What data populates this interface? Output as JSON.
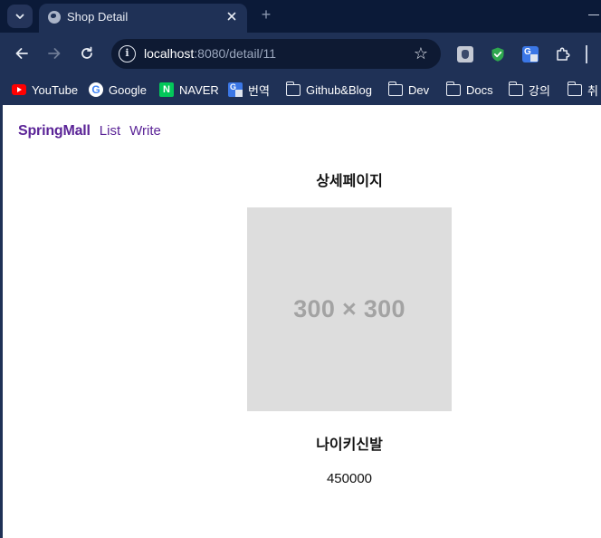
{
  "browser": {
    "tab_title": "Shop Detail",
    "new_tab_symbol": "+",
    "url_host": "localhost",
    "url_rest": ":8080/detail/11",
    "bookmarks": [
      {
        "label": "YouTube",
        "icon": "youtube-icon"
      },
      {
        "label": "Google",
        "icon": "google-icon"
      },
      {
        "label": "NAVER",
        "icon": "naver-icon"
      },
      {
        "label": "번역",
        "icon": "translate-icon"
      },
      {
        "label": "Github&Blog",
        "icon": "folder-icon"
      },
      {
        "label": "Dev",
        "icon": "folder-icon"
      },
      {
        "label": "Docs",
        "icon": "folder-icon"
      },
      {
        "label": "강의",
        "icon": "folder-icon"
      },
      {
        "label": "취",
        "icon": "folder-icon"
      }
    ]
  },
  "navbar": {
    "brand": "SpringMall",
    "links": [
      "List",
      "Write"
    ]
  },
  "detail": {
    "title": "상세페이지",
    "image_placeholder": "300 × 300",
    "product_name": "나이키신발",
    "price": "450000"
  }
}
